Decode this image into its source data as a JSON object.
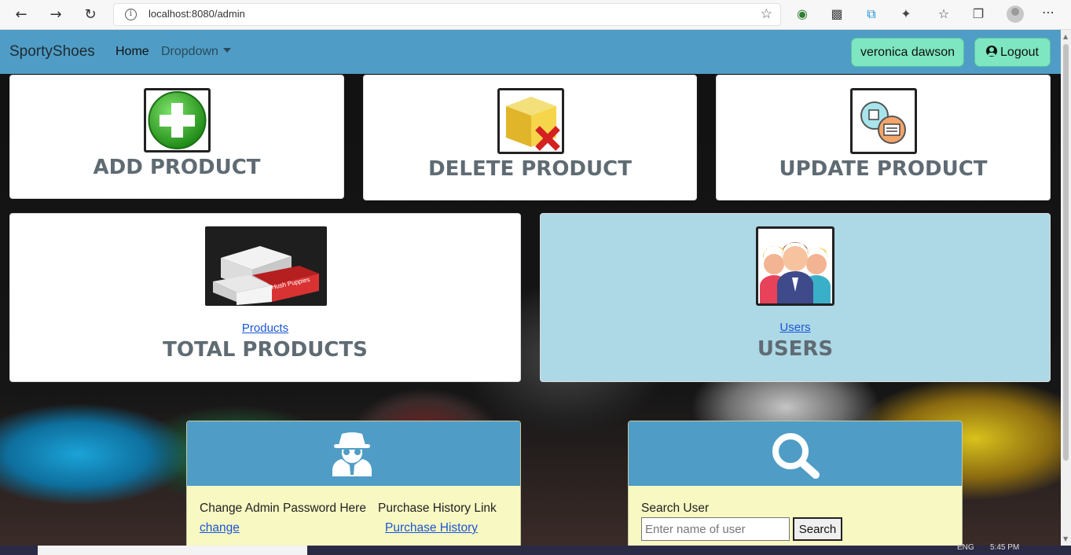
{
  "browser": {
    "url": "localhost:8080/admin"
  },
  "navbar": {
    "brand": "SportyShoes",
    "home": "Home",
    "dropdown": "Dropdown",
    "user_name": "veronica dawson",
    "logout": "Logout"
  },
  "cards": {
    "add": {
      "title": "ADD PRODUCT"
    },
    "delete": {
      "title": "DELETE PRODUCT"
    },
    "update": {
      "title": "UPDATE PRODUCT"
    },
    "products": {
      "link": "Products",
      "title": "TOTAL PRODUCTS",
      "image_text": "Hush Puppies"
    },
    "users": {
      "link": "Users",
      "title": "USERS"
    }
  },
  "admin_panel": {
    "change_text": "Change Admin Password Here",
    "change_link": "change",
    "history_text": "Purchase History Link",
    "history_link": "Purchase History"
  },
  "search_panel": {
    "label": "Search User",
    "placeholder": "Enter name of user",
    "button": "Search"
  },
  "taskbar": {
    "lang": "ENG",
    "time": "5:45 PM"
  },
  "colors": {
    "navbar": "#4f9dc6",
    "pill": "#7ee6c0",
    "users_card": "#add8e6",
    "panel_body": "#f7f8c2",
    "link": "#1a56d6"
  }
}
